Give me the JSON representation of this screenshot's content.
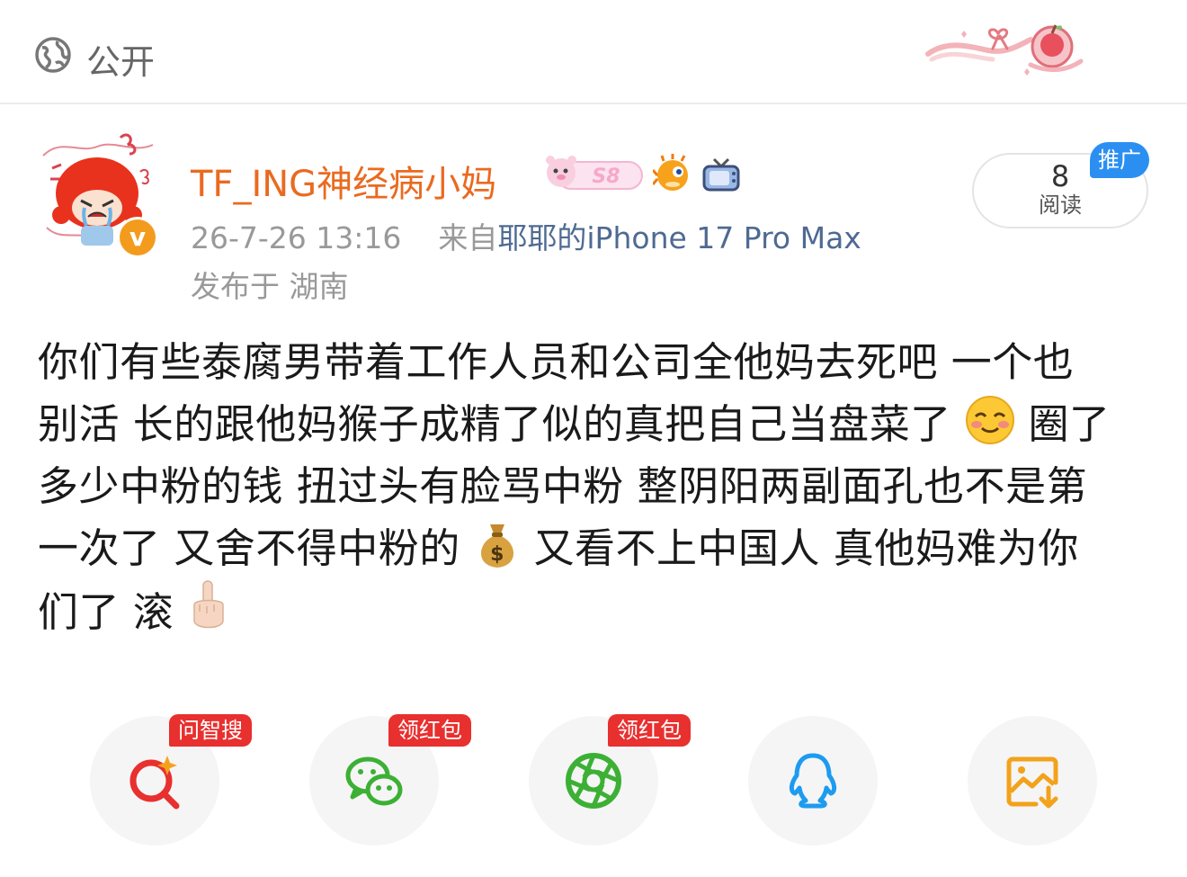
{
  "topbar": {
    "visibility_label": "公开",
    "globe_icon": "globe-icon"
  },
  "post": {
    "username": "TF_ING神经病小妈",
    "verified_badge_icon": "verified-v-icon",
    "badges": [
      "level-badge-icon",
      "pufferfish-badge-icon",
      "tv-badge-icon"
    ],
    "level_badge_text": "S8",
    "timestamp": "26-7-26 13:16",
    "source_prefix": "来自",
    "device": "耶耶的iPhone 17 Pro Max",
    "location": "发布于 湖南",
    "read_count": "8",
    "read_label": "阅读",
    "promote_tag": "推广",
    "body_lines": [
      "你们有些泰腐男带着工作人员和公司全他妈去死吧 一个也",
      "别活 长的跟他妈猴子成精了似的真把自己当盘菜了",
      "圈了",
      "多少中粉的钱 扭过头有脸骂中粉 整阴阳两副面孔也不是第",
      "一次了 又舍不得中粉的",
      "又看不上中国人 真他妈难为你",
      "们了 滚"
    ],
    "emojis": [
      "smiling-blush-emoji",
      "money-bag-emoji",
      "middle-finger-emoji"
    ]
  },
  "share": {
    "items": [
      {
        "icon": "ai-search-icon",
        "tag": "问智搜",
        "color": "#e8302f"
      },
      {
        "icon": "wechat-icon",
        "tag": "领红包",
        "color": "#3cb035"
      },
      {
        "icon": "moments-icon",
        "tag": "领红包",
        "color": "#3cb035"
      },
      {
        "icon": "qq-icon",
        "tag": "",
        "color": "#1d9bf0"
      },
      {
        "icon": "save-image-icon",
        "tag": "",
        "color": "#f2a21b"
      }
    ]
  },
  "colors": {
    "username": "#ea6a20",
    "device_link": "#4f6a92",
    "promote": "#2b8ff2",
    "share_tag": "#e8302f"
  }
}
